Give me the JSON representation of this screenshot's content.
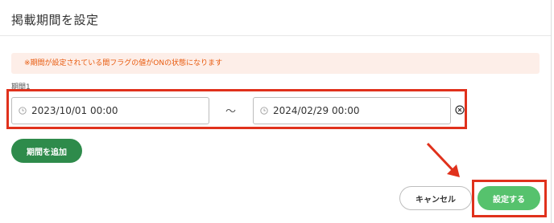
{
  "dialog": {
    "title": "掲載期間を設定",
    "notice": "※期間が設定されている間フラグの値がONの状態になります"
  },
  "period": {
    "label": "期間1",
    "start": "2023/10/01 00:00",
    "separator": "〜",
    "end": "2024/02/29 00:00"
  },
  "buttons": {
    "add_period": "期間を追加",
    "cancel": "キャンセル",
    "submit": "設定する"
  },
  "colors": {
    "accent_dark_green": "#2e8b4b",
    "accent_light_green": "#56c26d",
    "highlight_red": "#e0311c",
    "notice_text": "#e8590c",
    "notice_bg": "#fdeee8"
  },
  "icons": {
    "start_clock": "clock-icon",
    "end_clock": "clock-icon",
    "clear": "clear-icon",
    "annotation": "arrow-icon"
  }
}
